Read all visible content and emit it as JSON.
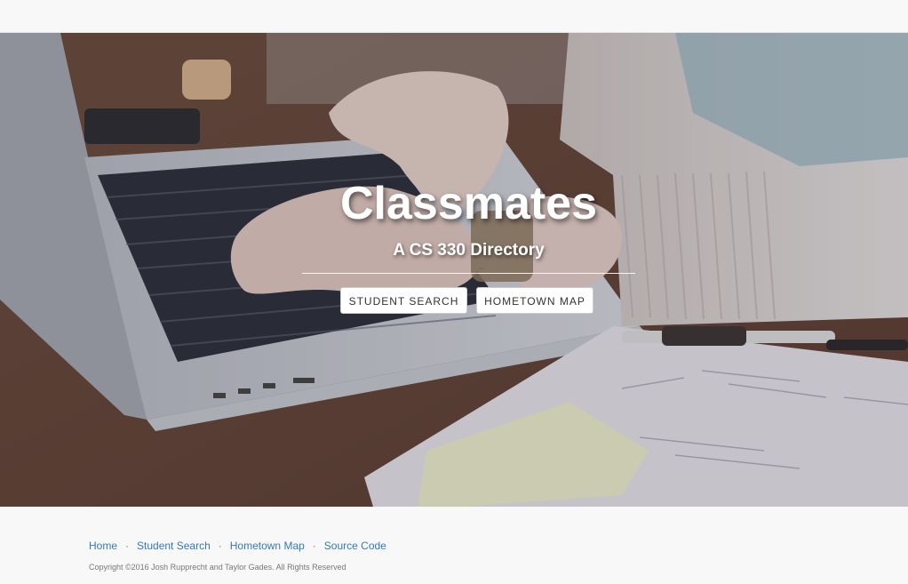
{
  "hero": {
    "title": "Classmates",
    "subtitle": "A CS 330 Directory",
    "buttons": {
      "student_search": "STUDENT SEARCH",
      "hometown_map": "HOMETOWN MAP"
    }
  },
  "footer": {
    "links": [
      "Home",
      "Student Search",
      "Hometown Map",
      "Source Code"
    ],
    "separator": "·",
    "copyright": "Copyright ©2016 Josh Rupprecht and Taylor Gades. All Rights Reserved"
  },
  "colors": {
    "link": "#337ab7",
    "muted": "#777777",
    "background": "#f8f8f8"
  }
}
